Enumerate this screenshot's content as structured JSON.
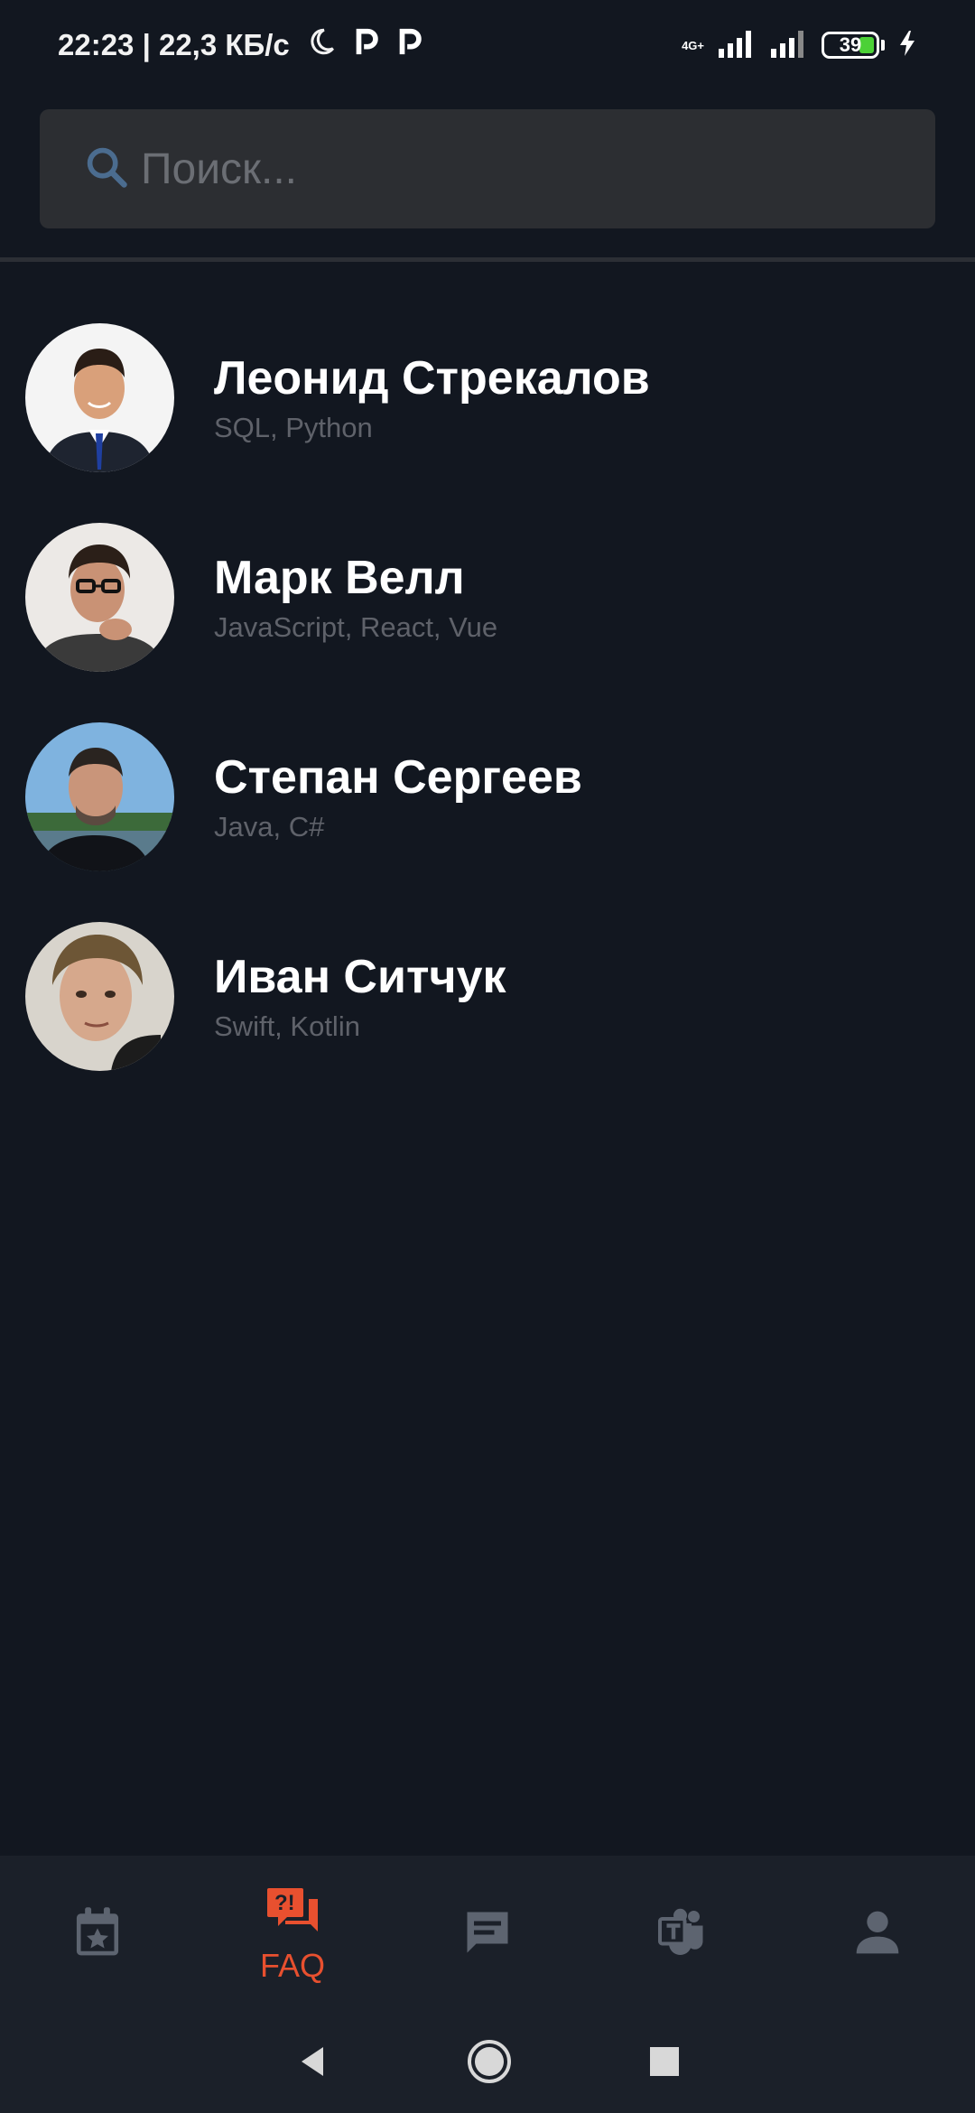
{
  "status_bar": {
    "time_speed": "22:23 | 22,3 КБ/с",
    "network_label": "4G+",
    "battery_level": "39"
  },
  "search": {
    "placeholder": "Поиск..."
  },
  "contacts": [
    {
      "name": "Леонид Стрекалов",
      "skills": "SQL, Python"
    },
    {
      "name": "Марк Велл",
      "skills": "JavaScript, React, Vue"
    },
    {
      "name": "Степан Сергеев",
      "skills": "Java, C#"
    },
    {
      "name": "Иван Ситчук",
      "skills": "Swift, Kotlin"
    }
  ],
  "bottom_nav": {
    "items": [
      {
        "icon": "calendar-star-icon",
        "label": ""
      },
      {
        "icon": "faq-icon",
        "label": "FAQ",
        "active": true
      },
      {
        "icon": "chat-icon",
        "label": ""
      },
      {
        "icon": "teams-icon",
        "label": ""
      },
      {
        "icon": "profile-icon",
        "label": ""
      }
    ]
  },
  "colors": {
    "background": "#121720",
    "accent": "#e8502f",
    "inactive_icon": "#5d6470",
    "search_bg": "#2c2e32"
  }
}
